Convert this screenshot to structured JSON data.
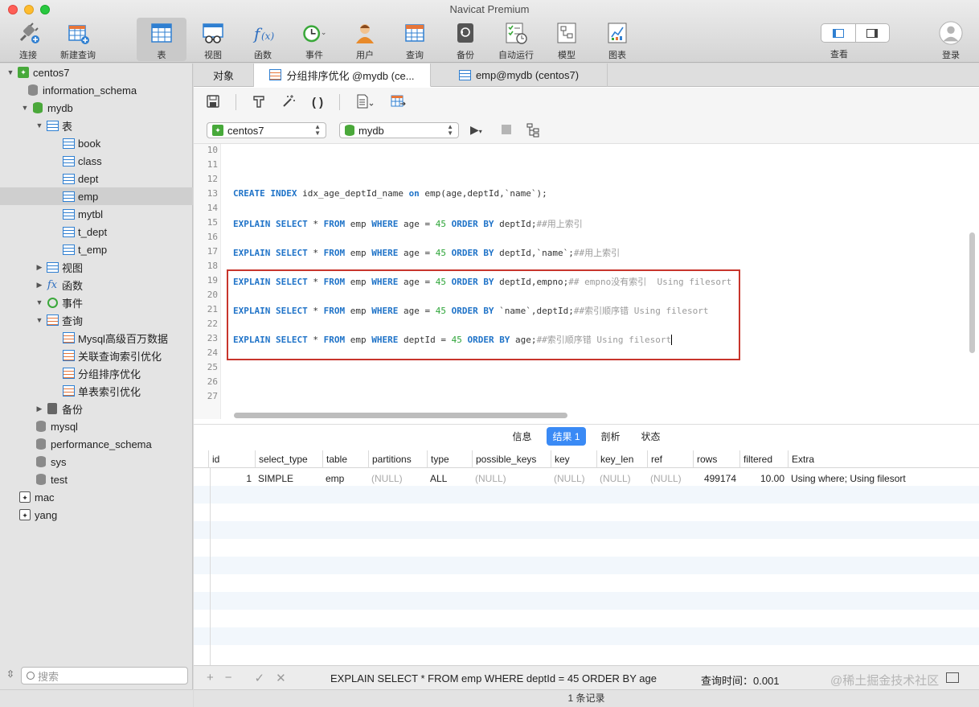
{
  "window": {
    "title": "Navicat Premium"
  },
  "toolbar": {
    "items": [
      {
        "label": "连接",
        "icon": "plug-icon"
      },
      {
        "label": "新建查询",
        "icon": "new-query-icon"
      },
      {
        "label": "表",
        "icon": "table-icon"
      },
      {
        "label": "视图",
        "icon": "view-icon"
      },
      {
        "label": "函数",
        "icon": "function-icon"
      },
      {
        "label": "事件",
        "icon": "clock-icon"
      },
      {
        "label": "用户",
        "icon": "user-icon"
      },
      {
        "label": "查询",
        "icon": "query-icon"
      },
      {
        "label": "备份",
        "icon": "backup-icon"
      },
      {
        "label": "自动运行",
        "icon": "checklist-icon"
      },
      {
        "label": "模型",
        "icon": "model-icon"
      },
      {
        "label": "图表",
        "icon": "chart-icon"
      }
    ],
    "view_label": "查看",
    "login_label": "登录"
  },
  "sidebar": {
    "connection": "centos7",
    "schemas": [
      "information_schema",
      "mydb"
    ],
    "tables_group": "表",
    "tables": [
      "book",
      "class",
      "dept",
      "emp",
      "mytbl",
      "t_dept",
      "t_emp"
    ],
    "views": "视图",
    "functions": "函数",
    "events": "事件",
    "queries_group": "查询",
    "queries": [
      "Mysql高级百万数据",
      "关联查询索引优化",
      "分组排序优化",
      "单表索引优化"
    ],
    "backup": "备份",
    "other_schemas": [
      "mysql",
      "performance_schema",
      "sys",
      "test"
    ],
    "connections": [
      "mac",
      "yang"
    ],
    "search_placeholder": "搜索"
  },
  "tabs": [
    {
      "label": "对象"
    },
    {
      "label": "分组排序优化 @mydb (ce..."
    },
    {
      "label": "emp@mydb (centos7)"
    }
  ],
  "conn_select": "centos7",
  "db_select": "mydb",
  "editor": {
    "line_numbers": [
      "10",
      "11",
      "12",
      "13",
      "14",
      "15",
      "16",
      "17",
      "18",
      "19",
      "20",
      "21",
      "22",
      "23",
      "24",
      "25",
      "26",
      "27"
    ]
  },
  "result_tabs": [
    {
      "label": "信息"
    },
    {
      "label": "结果 1"
    },
    {
      "label": "剖析"
    },
    {
      "label": "状态"
    }
  ],
  "grid": {
    "columns": [
      "id",
      "select_type",
      "table",
      "partitions",
      "type",
      "possible_keys",
      "key",
      "key_len",
      "ref",
      "rows",
      "filtered",
      "Extra"
    ],
    "row": [
      "1",
      "SIMPLE",
      "emp",
      "(NULL)",
      "ALL",
      "(NULL)",
      "(NULL)",
      "(NULL)",
      "(NULL)",
      "499174",
      "10.00",
      "Using where; Using filesort"
    ]
  },
  "status": {
    "sql": "EXPLAIN SELECT * FROM emp WHERE deptId = 45 ORDER BY age",
    "time": "查询时间：0.001",
    "records": "1 条记录",
    "watermark": "@稀土掘金技术社区"
  }
}
